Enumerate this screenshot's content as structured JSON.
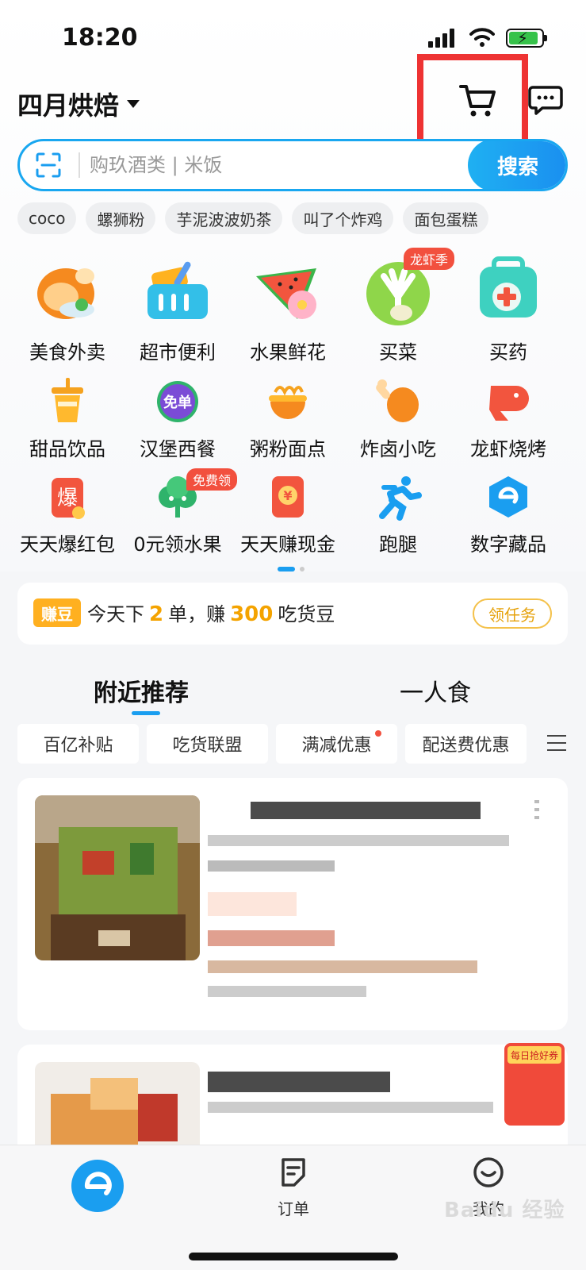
{
  "status_bar": {
    "time": "18:20"
  },
  "header": {
    "store_name": "四月烘焙"
  },
  "search": {
    "placeholder": "购玖酒类 | 米饭",
    "button_label": "搜索"
  },
  "quick_tags": [
    "coco",
    "螺狮粉",
    "芋泥波波奶茶",
    "叫了个炸鸡",
    "面包蛋糕"
  ],
  "categories_row1": [
    {
      "label": "美食外卖",
      "icon": "roast-chicken-icon"
    },
    {
      "label": "超市便利",
      "icon": "shopping-basket-icon"
    },
    {
      "label": "水果鲜花",
      "icon": "watermelon-flower-icon"
    },
    {
      "label": "买菜",
      "icon": "vegetable-icon",
      "badge": "龙虾季"
    },
    {
      "label": "买药",
      "icon": "medicine-box-icon"
    }
  ],
  "categories_row2": [
    {
      "label": "甜品饮品",
      "icon": "drink-cup-icon"
    },
    {
      "label": "汉堡西餐",
      "icon": "burger-icon",
      "badge_inline": "免单"
    },
    {
      "label": "粥粉面点",
      "icon": "noodle-bowl-icon"
    },
    {
      "label": "炸卤小吃",
      "icon": "drumstick-icon"
    },
    {
      "label": "龙虾烧烤",
      "icon": "lobster-icon"
    }
  ],
  "categories_row3": [
    {
      "label": "天天爆红包",
      "icon": "red-packet-icon",
      "icon_text": "爆"
    },
    {
      "label": "0元领水果",
      "icon": "fruit-tree-icon",
      "badge": "免费领"
    },
    {
      "label": "天天赚现金",
      "icon": "cash-envelope-icon",
      "icon_text": "¥"
    },
    {
      "label": "跑腿",
      "icon": "runner-icon"
    },
    {
      "label": "数字藏品",
      "icon": "digital-collectible-icon"
    }
  ],
  "earn": {
    "tag": "赚豆",
    "text_1": "今天下",
    "num_1": "2",
    "text_2": "单，赚",
    "num_2": "300",
    "text_3": "吃货豆",
    "button": "领任务"
  },
  "feed_tabs": [
    "附近推荐",
    "一人食"
  ],
  "filters": [
    "百亿补贴",
    "吃货联盟",
    "满减优惠",
    "配送费优惠"
  ],
  "coupon_float": {
    "text": "每日抢好券"
  },
  "bottom_nav": {
    "orders": "订单",
    "mine": "我的"
  },
  "watermark": "Baidu 经验",
  "colors": {
    "accent": "#1a9ef0",
    "highlight_box": "#ee3333",
    "beans": "#f4a300"
  }
}
